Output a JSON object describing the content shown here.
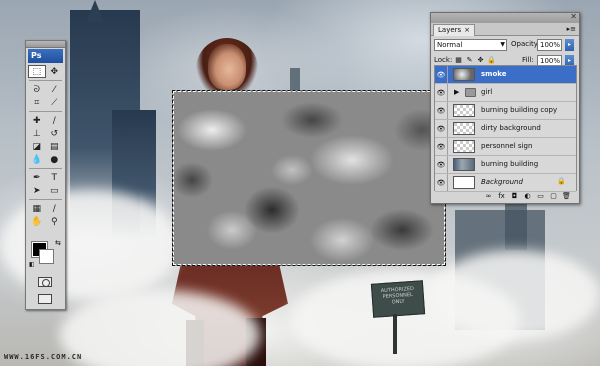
{
  "tools": {
    "badge": "Ps",
    "rows": [
      [
        "marquee-icon",
        "move-icon"
      ],
      [
        "lasso-icon",
        "magic-wand-icon"
      ],
      [
        "crop-icon",
        "slice-icon"
      ],
      [
        "healing-brush-icon",
        "brush-icon"
      ],
      [
        "clone-stamp-icon",
        "history-brush-icon"
      ],
      [
        "eraser-icon",
        "gradient-icon"
      ],
      [
        "blur-icon",
        "dodge-icon"
      ],
      [
        "pen-icon",
        "type-icon"
      ],
      [
        "path-select-icon",
        "shape-icon"
      ],
      [
        "notes-icon",
        "eyedropper-icon"
      ],
      [
        "hand-icon",
        "zoom-icon"
      ]
    ],
    "glyphs": {
      "marquee-icon": "⬚",
      "move-icon": "✥",
      "lasso-icon": "ᘐ",
      "magic-wand-icon": "⁄",
      "crop-icon": "⌗",
      "slice-icon": "⟋",
      "healing-brush-icon": "✚",
      "brush-icon": "∕",
      "clone-stamp-icon": "⊥",
      "history-brush-icon": "↺",
      "eraser-icon": "◪",
      "gradient-icon": "▤",
      "blur-icon": "💧",
      "dodge-icon": "●",
      "pen-icon": "✒",
      "type-icon": "T",
      "path-select-icon": "➤",
      "shape-icon": "▭",
      "notes-icon": "▦",
      "eyedropper-icon": "∕",
      "hand-icon": "✋",
      "zoom-icon": "⚲"
    },
    "foreground_color": "#000000",
    "background_color": "#ffffff"
  },
  "layers_panel": {
    "tab_label": "Layers",
    "tab_close": "×",
    "blend_mode": "Normal",
    "opacity_label": "Opacity:",
    "opacity_value": "100%",
    "lock_label": "Lock:",
    "fill_label": "Fill:",
    "fill_value": "100%",
    "layers": [
      {
        "name": "smoke",
        "thumb": "smoke",
        "active": true
      },
      {
        "name": "girl",
        "thumb": "folder",
        "active": false
      },
      {
        "name": "burning building copy",
        "thumb": "transparent",
        "active": false
      },
      {
        "name": "dirty background",
        "thumb": "transparent",
        "active": false
      },
      {
        "name": "personnel sign",
        "thumb": "transparent",
        "active": false
      },
      {
        "name": "burning building",
        "thumb": "photo",
        "active": false
      },
      {
        "name": "Background",
        "thumb": "white",
        "active": false,
        "locked": true
      }
    ]
  },
  "sign": {
    "lines": [
      "AUTHORIZED",
      "PERSONNEL",
      "ONLY"
    ]
  },
  "watermark": "WWW.16FS.COM.CN",
  "colors": {
    "accent": "#3b6fc7",
    "selection_marquee": "#111111"
  }
}
